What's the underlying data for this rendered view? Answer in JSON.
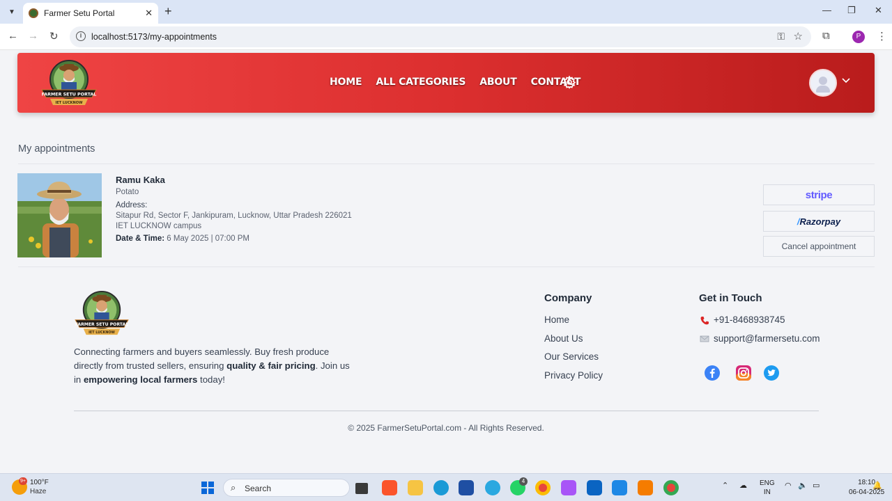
{
  "browser": {
    "tab_title": "Farmer Setu Portal",
    "url": "localhost:5173/my-appointments",
    "profile_initial": "P"
  },
  "header": {
    "logo_text": "FARMER SETU PORTAL",
    "logo_subtext": "IET LUCKNOW",
    "nav": [
      "HOME",
      "ALL CATEGORIES",
      "ABOUT",
      "CONTACT"
    ],
    "colors": {
      "gradient_start": "#ef4444",
      "gradient_end": "#b91c1c"
    }
  },
  "main": {
    "title": "My appointments",
    "appointment": {
      "name": "Ramu Kaka",
      "crop": "Potato",
      "address_label": "Address:",
      "address_line1": "Sitapur Rd, Sector F, Jankipuram, Lucknow, Uttar Pradesh 226021",
      "address_line2": "IET LUCKNOW campus",
      "datetime_label": "Date & Time:",
      "datetime_value": "6 May 2025 | 07:00 PM"
    },
    "actions": {
      "stripe": "stripe",
      "razorpay": "Razorpay",
      "cancel": "Cancel appointment"
    }
  },
  "footer": {
    "about_part1": "Connecting farmers and buyers seamlessly. Buy fresh produce directly from trusted sellers, ensuring ",
    "about_bold1": "quality & fair pricing",
    "about_part2": ". Join us in ",
    "about_bold2": "empowering local farmers",
    "about_part3": " today!",
    "company_title": "Company",
    "company_links": [
      "Home",
      "About Us",
      "Our Services",
      "Privacy Policy"
    ],
    "contact_title": "Get in Touch",
    "phone": "+91-8468938745",
    "email": "support@farmersetu.com",
    "social": [
      "facebook-icon",
      "instagram-icon",
      "twitter-icon"
    ],
    "copyright": "© 2025 FarmerSetuPortal.com - All Rights Reserved."
  },
  "taskbar": {
    "weather_badge": "9+",
    "temperature": "100°F",
    "weather": "Haze",
    "search_label": "Search",
    "whatsapp_badge": "4",
    "lang1": "ENG",
    "lang2": "IN",
    "time": "18:10",
    "date": "06-04-2025"
  }
}
